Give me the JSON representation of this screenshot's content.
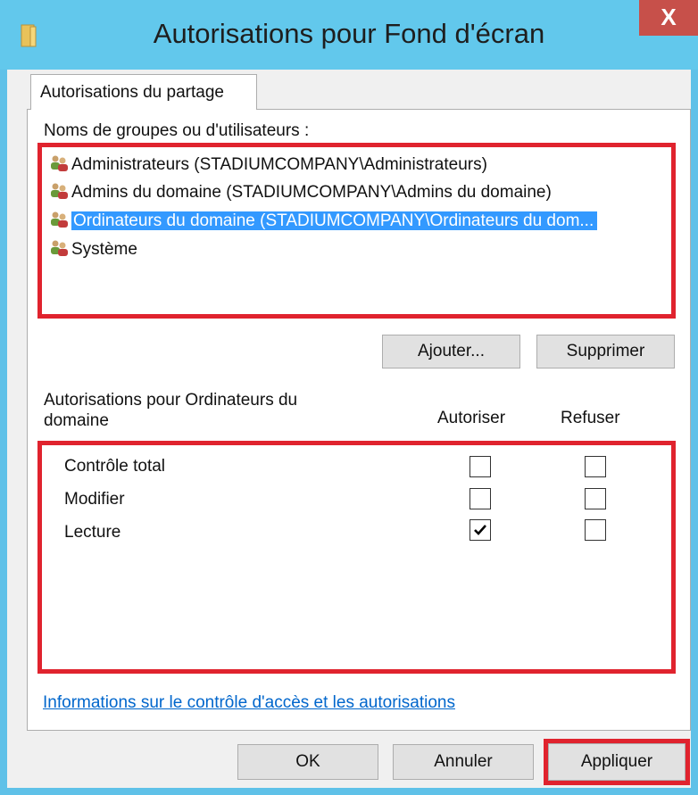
{
  "window": {
    "title": "Autorisations pour Fond d'écran",
    "close_label": "X"
  },
  "tabs": [
    {
      "label": "Autorisations du partage",
      "active": true
    }
  ],
  "groups": {
    "label": "Noms de groupes ou d'utilisateurs :",
    "items": [
      {
        "label": "Administrateurs (STADIUMCOMPANY\\Administrateurs)",
        "icon": "users-icon",
        "selected": false
      },
      {
        "label": "Admins du domaine (STADIUMCOMPANY\\Admins du domaine)",
        "icon": "users-icon",
        "selected": false
      },
      {
        "label": "Ordinateurs du domaine (STADIUMCOMPANY\\Ordinateurs du dom...",
        "icon": "users-icon",
        "selected": true
      },
      {
        "label": "Système",
        "icon": "users-icon",
        "selected": false
      }
    ],
    "add_label": "Ajouter...",
    "remove_label": "Supprimer"
  },
  "permissions": {
    "heading_line1": "Autorisations pour Ordinateurs du",
    "heading_line2": "domaine",
    "col_allow": "Autoriser",
    "col_deny": "Refuser",
    "rows": [
      {
        "label": "Contrôle total",
        "allow": false,
        "deny": false
      },
      {
        "label": "Modifier",
        "allow": false,
        "deny": false
      },
      {
        "label": "Lecture",
        "allow": true,
        "deny": false
      }
    ]
  },
  "info_link": "Informations sur le contrôle d'accès et les autorisations",
  "footer": {
    "ok_label": "OK",
    "cancel_label": "Annuler",
    "apply_label": "Appliquer"
  },
  "colors": {
    "titlebar": "#62c8ec",
    "close_button": "#c7504a",
    "highlight": "#e0232e",
    "selection": "#3399ff",
    "link": "#0066cc"
  }
}
